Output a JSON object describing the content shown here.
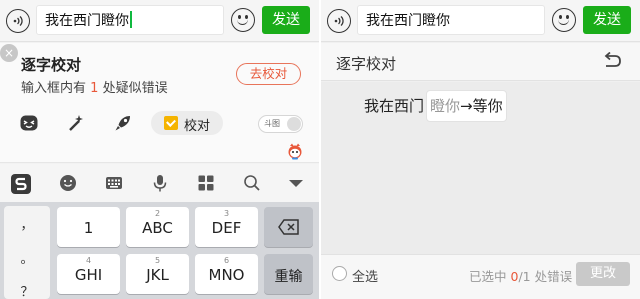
{
  "left": {
    "chat": {
      "input_text": "我在西门瞪你",
      "send_label": "发送"
    },
    "proofread_card": {
      "close_glyph": "×",
      "title": "逐字校对",
      "subtitle_prefix": "输入框内有",
      "error_count": "1",
      "subtitle_suffix": "处疑似错误",
      "action_label": "去校对"
    },
    "toolbar": {
      "proofread_label": "校对",
      "toggle_label": "斗图"
    },
    "keyboard": {
      "side_keys": [
        "，",
        "。",
        "？"
      ],
      "keys": [
        {
          "main": "1",
          "sub": ""
        },
        {
          "main": "ABC",
          "sub": "2"
        },
        {
          "main": "DEF",
          "sub": "3"
        },
        {
          "main": "GHI",
          "sub": "4"
        },
        {
          "main": "JKL",
          "sub": "5"
        },
        {
          "main": "MNO",
          "sub": "6"
        }
      ],
      "reenter_label": "重输"
    },
    "icons": [
      "voice-icon",
      "emoji-icon",
      "emoticon-face-icon",
      "magic-wand-icon",
      "rocket-icon",
      "proofread-icon",
      "mascot-icon",
      "sogou-logo-icon",
      "smiley-icon",
      "keyboard-icon",
      "microphone-icon",
      "grid-icon",
      "search-icon",
      "collapse-icon",
      "backspace-icon"
    ]
  },
  "right": {
    "chat": {
      "input_text": "我在西门瞪你",
      "send_label": "发送"
    },
    "title": "逐字校对",
    "sentence_prefix": "我在西门",
    "wrong_text": "瞪你",
    "arrow": "→",
    "corrected_text": "等你",
    "select_all_label": "全选",
    "status_prefix": "已选中",
    "selected_count": "0",
    "status_mid": "/1",
    "status_suffix": "处错误",
    "apply_label": "更改",
    "colors": {
      "accent_green": "#1aad19",
      "error_red": "#e8583a"
    }
  }
}
